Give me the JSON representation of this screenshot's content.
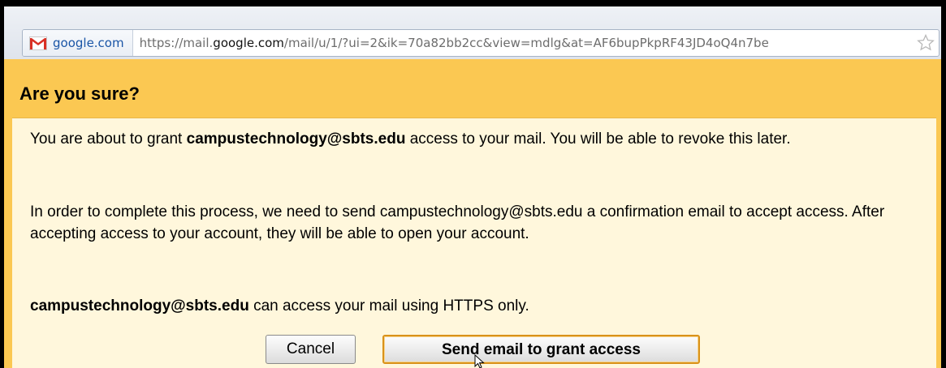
{
  "address_bar": {
    "site_label": "google.com",
    "url_prefix": "https://mail.",
    "url_domain": "google.com",
    "url_rest": "/mail/u/1/?ui=2&ik=70a82bb2cc&view=mdlg&at=AF6bupPkpRF43JD4oQ4n7be",
    "site_icon": "gmail-icon",
    "bookmark_icon": "star-icon"
  },
  "dialog": {
    "title": "Are you sure?",
    "para1_before": "You are about to grant ",
    "para1_email": "campustechnology@sbts.edu",
    "para1_after": " access to your mail. You will be able to revoke this later.",
    "para2": "In order to complete this process, we need to send campustechnology@sbts.edu a confirmation email to accept access. After accepting access to your account, they will be able to open your account.",
    "para3_email": "campustechnology@sbts.edu",
    "para3_after": " can access your mail using HTTPS only.",
    "cancel_label": "Cancel",
    "send_label": "Send email to grant access"
  },
  "colors": {
    "dialog_header": "#fbc852",
    "dialog_body": "#fff7dc",
    "primary_button_border": "#d9921a"
  }
}
